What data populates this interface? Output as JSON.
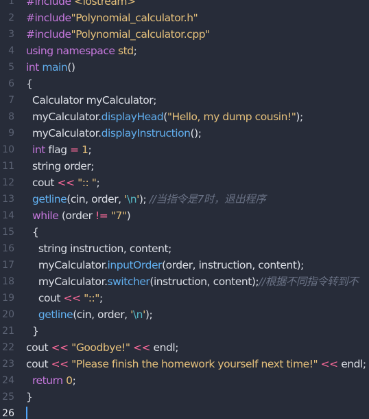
{
  "editor": {
    "lines": [
      {
        "n": "1",
        "tokens": [
          {
            "t": "#include ",
            "c": "kw"
          },
          {
            "t": "<iostream>",
            "c": "inc"
          }
        ]
      },
      {
        "n": "2",
        "tokens": [
          {
            "t": "#include",
            "c": "kw"
          },
          {
            "t": "\"Polynomial_calculator.h\"",
            "c": "str"
          }
        ]
      },
      {
        "n": "3",
        "tokens": [
          {
            "t": "#include",
            "c": "kw"
          },
          {
            "t": "\"Polynomial_calculator.cpp\"",
            "c": "str"
          }
        ]
      },
      {
        "n": "4",
        "tokens": [
          {
            "t": "using namespace ",
            "c": "kw"
          },
          {
            "t": "std",
            "c": "str"
          },
          {
            "t": ";",
            "c": "plain"
          }
        ]
      },
      {
        "n": "5",
        "tokens": [
          {
            "t": "int ",
            "c": "kw"
          },
          {
            "t": "main",
            "c": "fn"
          },
          {
            "t": "()",
            "c": "plain"
          }
        ]
      },
      {
        "n": "6",
        "tokens": [
          {
            "t": "{",
            "c": "plain"
          }
        ]
      },
      {
        "n": "7",
        "tokens": [
          {
            "t": "  Calculator myCalculator;",
            "c": "plain"
          }
        ]
      },
      {
        "n": "8",
        "tokens": [
          {
            "t": "  myCalculator.",
            "c": "plain"
          },
          {
            "t": "displayHead",
            "c": "fn"
          },
          {
            "t": "(",
            "c": "plain"
          },
          {
            "t": "\"Hello, my dump cousin!\"",
            "c": "str"
          },
          {
            "t": ");",
            "c": "plain"
          }
        ]
      },
      {
        "n": "9",
        "tokens": [
          {
            "t": "  myCalculator.",
            "c": "plain"
          },
          {
            "t": "displayInstruction",
            "c": "fn"
          },
          {
            "t": "();",
            "c": "plain"
          }
        ]
      },
      {
        "n": "10",
        "tokens": [
          {
            "t": "  ",
            "c": "plain"
          },
          {
            "t": "int ",
            "c": "kw"
          },
          {
            "t": "flag ",
            "c": "plain"
          },
          {
            "t": "=",
            "c": "op"
          },
          {
            "t": " ",
            "c": "plain"
          },
          {
            "t": "1",
            "c": "num"
          },
          {
            "t": ";",
            "c": "plain"
          }
        ]
      },
      {
        "n": "11",
        "tokens": [
          {
            "t": "  string order;",
            "c": "plain"
          }
        ]
      },
      {
        "n": "12",
        "tokens": [
          {
            "t": "  cout ",
            "c": "plain"
          },
          {
            "t": "<<",
            "c": "op"
          },
          {
            "t": " ",
            "c": "plain"
          },
          {
            "t": "\":: \"",
            "c": "str"
          },
          {
            "t": ";",
            "c": "plain"
          }
        ]
      },
      {
        "n": "13",
        "tokens": [
          {
            "t": "  ",
            "c": "plain"
          },
          {
            "t": "getline",
            "c": "fn"
          },
          {
            "t": "(cin, order, ",
            "c": "plain"
          },
          {
            "t": "'",
            "c": "str"
          },
          {
            "t": "\\n",
            "c": "esc"
          },
          {
            "t": "'",
            "c": "str"
          },
          {
            "t": "); ",
            "c": "plain"
          },
          {
            "t": "//当指令是7时，退出程序",
            "c": "com"
          }
        ]
      },
      {
        "n": "14",
        "tokens": [
          {
            "t": "  ",
            "c": "plain"
          },
          {
            "t": "while",
            "c": "kw"
          },
          {
            "t": " (order ",
            "c": "plain"
          },
          {
            "t": "!=",
            "c": "op"
          },
          {
            "t": " ",
            "c": "plain"
          },
          {
            "t": "\"7\"",
            "c": "str"
          },
          {
            "t": ")",
            "c": "plain"
          }
        ]
      },
      {
        "n": "15",
        "tokens": [
          {
            "t": "  {",
            "c": "plain"
          }
        ]
      },
      {
        "n": "16",
        "tokens": [
          {
            "t": "    string instruction, content;",
            "c": "plain"
          }
        ]
      },
      {
        "n": "17",
        "tokens": [
          {
            "t": "    myCalculator.",
            "c": "plain"
          },
          {
            "t": "inputOrder",
            "c": "fn"
          },
          {
            "t": "(order, instruction, content);",
            "c": "plain"
          }
        ]
      },
      {
        "n": "18",
        "tokens": [
          {
            "t": "    myCalculator.",
            "c": "plain"
          },
          {
            "t": "switcher",
            "c": "fn"
          },
          {
            "t": "(instruction, content);",
            "c": "plain"
          },
          {
            "t": "//根据不同指令转到不",
            "c": "com"
          }
        ]
      },
      {
        "n": "19",
        "tokens": [
          {
            "t": "    cout ",
            "c": "plain"
          },
          {
            "t": "<<",
            "c": "op"
          },
          {
            "t": " ",
            "c": "plain"
          },
          {
            "t": "\"::\"",
            "c": "str"
          },
          {
            "t": ";",
            "c": "plain"
          }
        ]
      },
      {
        "n": "20",
        "tokens": [
          {
            "t": "    ",
            "c": "plain"
          },
          {
            "t": "getline",
            "c": "fn"
          },
          {
            "t": "(cin, order, ",
            "c": "plain"
          },
          {
            "t": "'",
            "c": "str"
          },
          {
            "t": "\\n",
            "c": "esc"
          },
          {
            "t": "'",
            "c": "str"
          },
          {
            "t": ");",
            "c": "plain"
          }
        ]
      },
      {
        "n": "21",
        "tokens": [
          {
            "t": "  }",
            "c": "plain"
          }
        ]
      },
      {
        "n": "22",
        "tokens": [
          {
            "t": "cout ",
            "c": "plain"
          },
          {
            "t": "<<",
            "c": "op"
          },
          {
            "t": " ",
            "c": "plain"
          },
          {
            "t": "\"Goodbye!\"",
            "c": "str"
          },
          {
            "t": " ",
            "c": "plain"
          },
          {
            "t": "<<",
            "c": "op"
          },
          {
            "t": " endl;",
            "c": "plain"
          }
        ]
      },
      {
        "n": "23",
        "tokens": [
          {
            "t": "cout ",
            "c": "plain"
          },
          {
            "t": "<<",
            "c": "op"
          },
          {
            "t": " ",
            "c": "plain"
          },
          {
            "t": "\"Please finish the homework yourself next time!\"",
            "c": "str"
          },
          {
            "t": " ",
            "c": "plain"
          },
          {
            "t": "<<",
            "c": "op"
          },
          {
            "t": " endl;",
            "c": "plain"
          }
        ]
      },
      {
        "n": "24",
        "tokens": [
          {
            "t": "  ",
            "c": "plain"
          },
          {
            "t": "return",
            "c": "kw"
          },
          {
            "t": " ",
            "c": "plain"
          },
          {
            "t": "0",
            "c": "num"
          },
          {
            "t": ";",
            "c": "plain"
          }
        ]
      },
      {
        "n": "25",
        "tokens": [
          {
            "t": "}",
            "c": "plain"
          }
        ]
      },
      {
        "n": "26",
        "tokens": [],
        "current": true
      }
    ]
  }
}
